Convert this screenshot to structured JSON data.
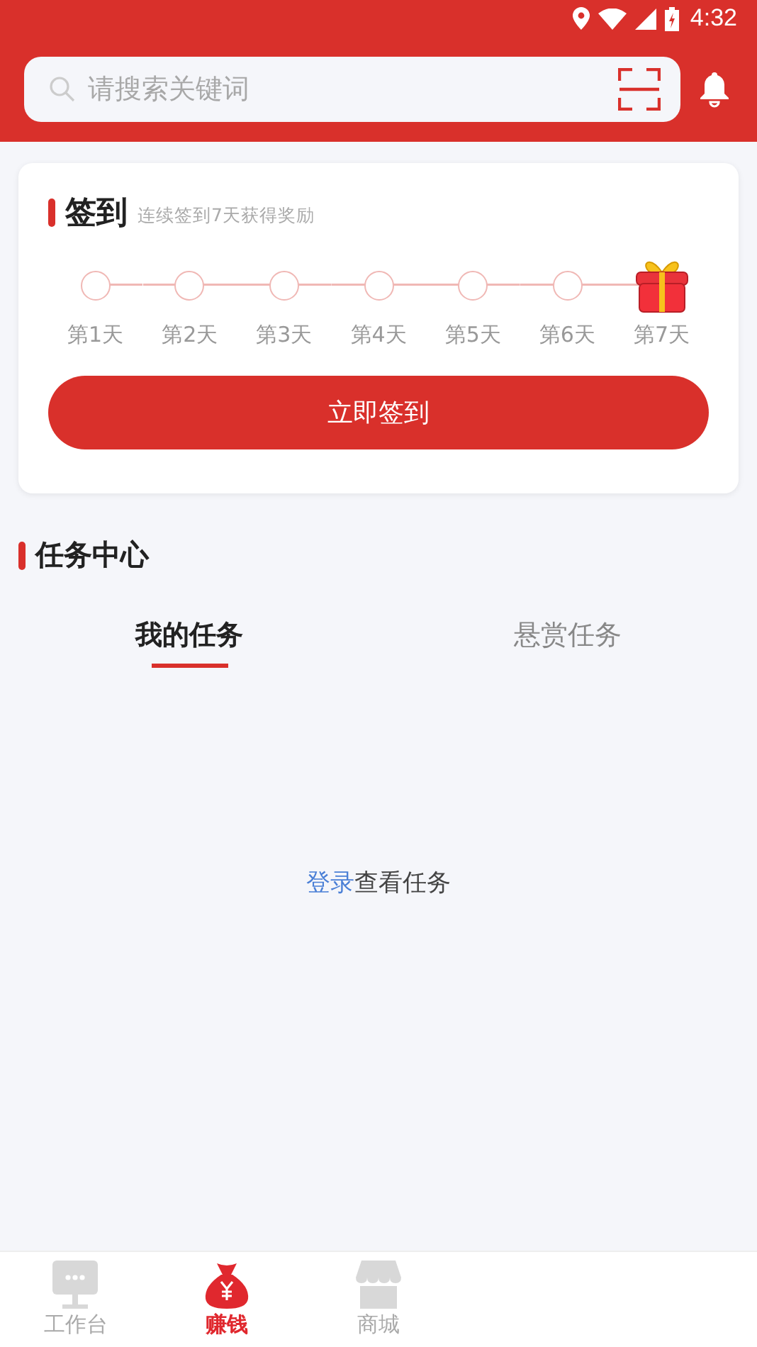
{
  "status_bar": {
    "time": "4:32"
  },
  "search": {
    "placeholder": "请搜索关键词"
  },
  "checkin": {
    "title": "签到",
    "subtitle": "连续签到7天获得奖励",
    "button": "立即签到",
    "days": [
      {
        "label": "第1天",
        "kind": "circle",
        "checked": false
      },
      {
        "label": "第2天",
        "kind": "circle",
        "checked": false
      },
      {
        "label": "第3天",
        "kind": "circle",
        "checked": false
      },
      {
        "label": "第4天",
        "kind": "circle",
        "checked": false
      },
      {
        "label": "第5天",
        "kind": "circle",
        "checked": false
      },
      {
        "label": "第6天",
        "kind": "circle",
        "checked": false
      },
      {
        "label": "第7天",
        "kind": "gift",
        "checked": false
      }
    ]
  },
  "task_center": {
    "title": "任务中心",
    "tabs": [
      {
        "label": "我的任务",
        "selected": true
      },
      {
        "label": "悬赏任务",
        "selected": false
      }
    ],
    "empty_message": {
      "link": "登录",
      "text": "查看任务"
    }
  },
  "bottom_nav": [
    {
      "label": "工作台",
      "kind": "desk",
      "selected": false
    },
    {
      "label": "赚钱",
      "kind": "bag",
      "selected": true
    },
    {
      "label": "商城",
      "kind": "shop",
      "selected": false
    }
  ]
}
